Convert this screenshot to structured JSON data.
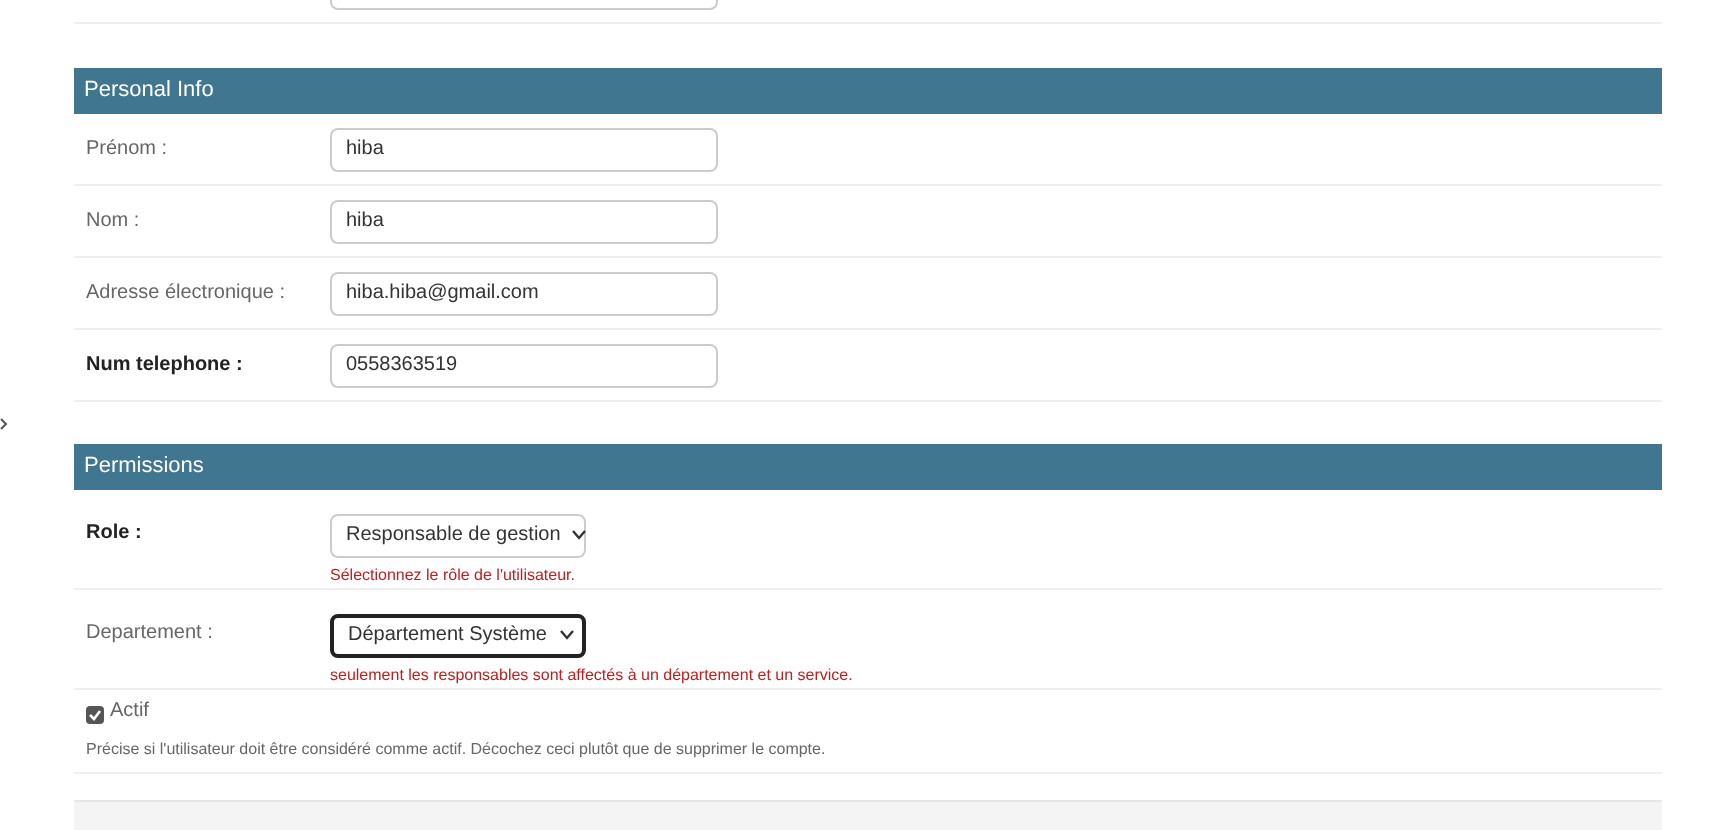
{
  "sections": [
    {
      "title": "Personal Info",
      "rows": [
        {
          "kind": "text",
          "label": "Prénom :",
          "bold": false,
          "value": "hiba"
        },
        {
          "kind": "text",
          "label": "Nom :",
          "bold": false,
          "value": "hiba"
        },
        {
          "kind": "text",
          "label": "Adresse électronique :",
          "bold": false,
          "value": "hiba.hiba@gmail.com"
        },
        {
          "kind": "text",
          "label": "Num telephone :",
          "bold": true,
          "value": "0558363519"
        }
      ]
    },
    {
      "title": "Permissions",
      "rows": [
        {
          "kind": "select",
          "label": "Role :",
          "bold": true,
          "value": "Responsable de gestion",
          "focused": false,
          "help": "Sélectionnez le rôle de l'utilisateur."
        },
        {
          "kind": "select",
          "label": "Departement :",
          "bold": false,
          "value": "Département Système",
          "focused": true,
          "help": "seulement les responsables sont affectés à un département et un service."
        },
        {
          "kind": "checkbox",
          "label": "Actif",
          "checked": true,
          "help": "Précise si l'utilisateur doit être considéré comme actif. Décochez ceci plutôt que de supprimer le compte."
        }
      ]
    }
  ]
}
